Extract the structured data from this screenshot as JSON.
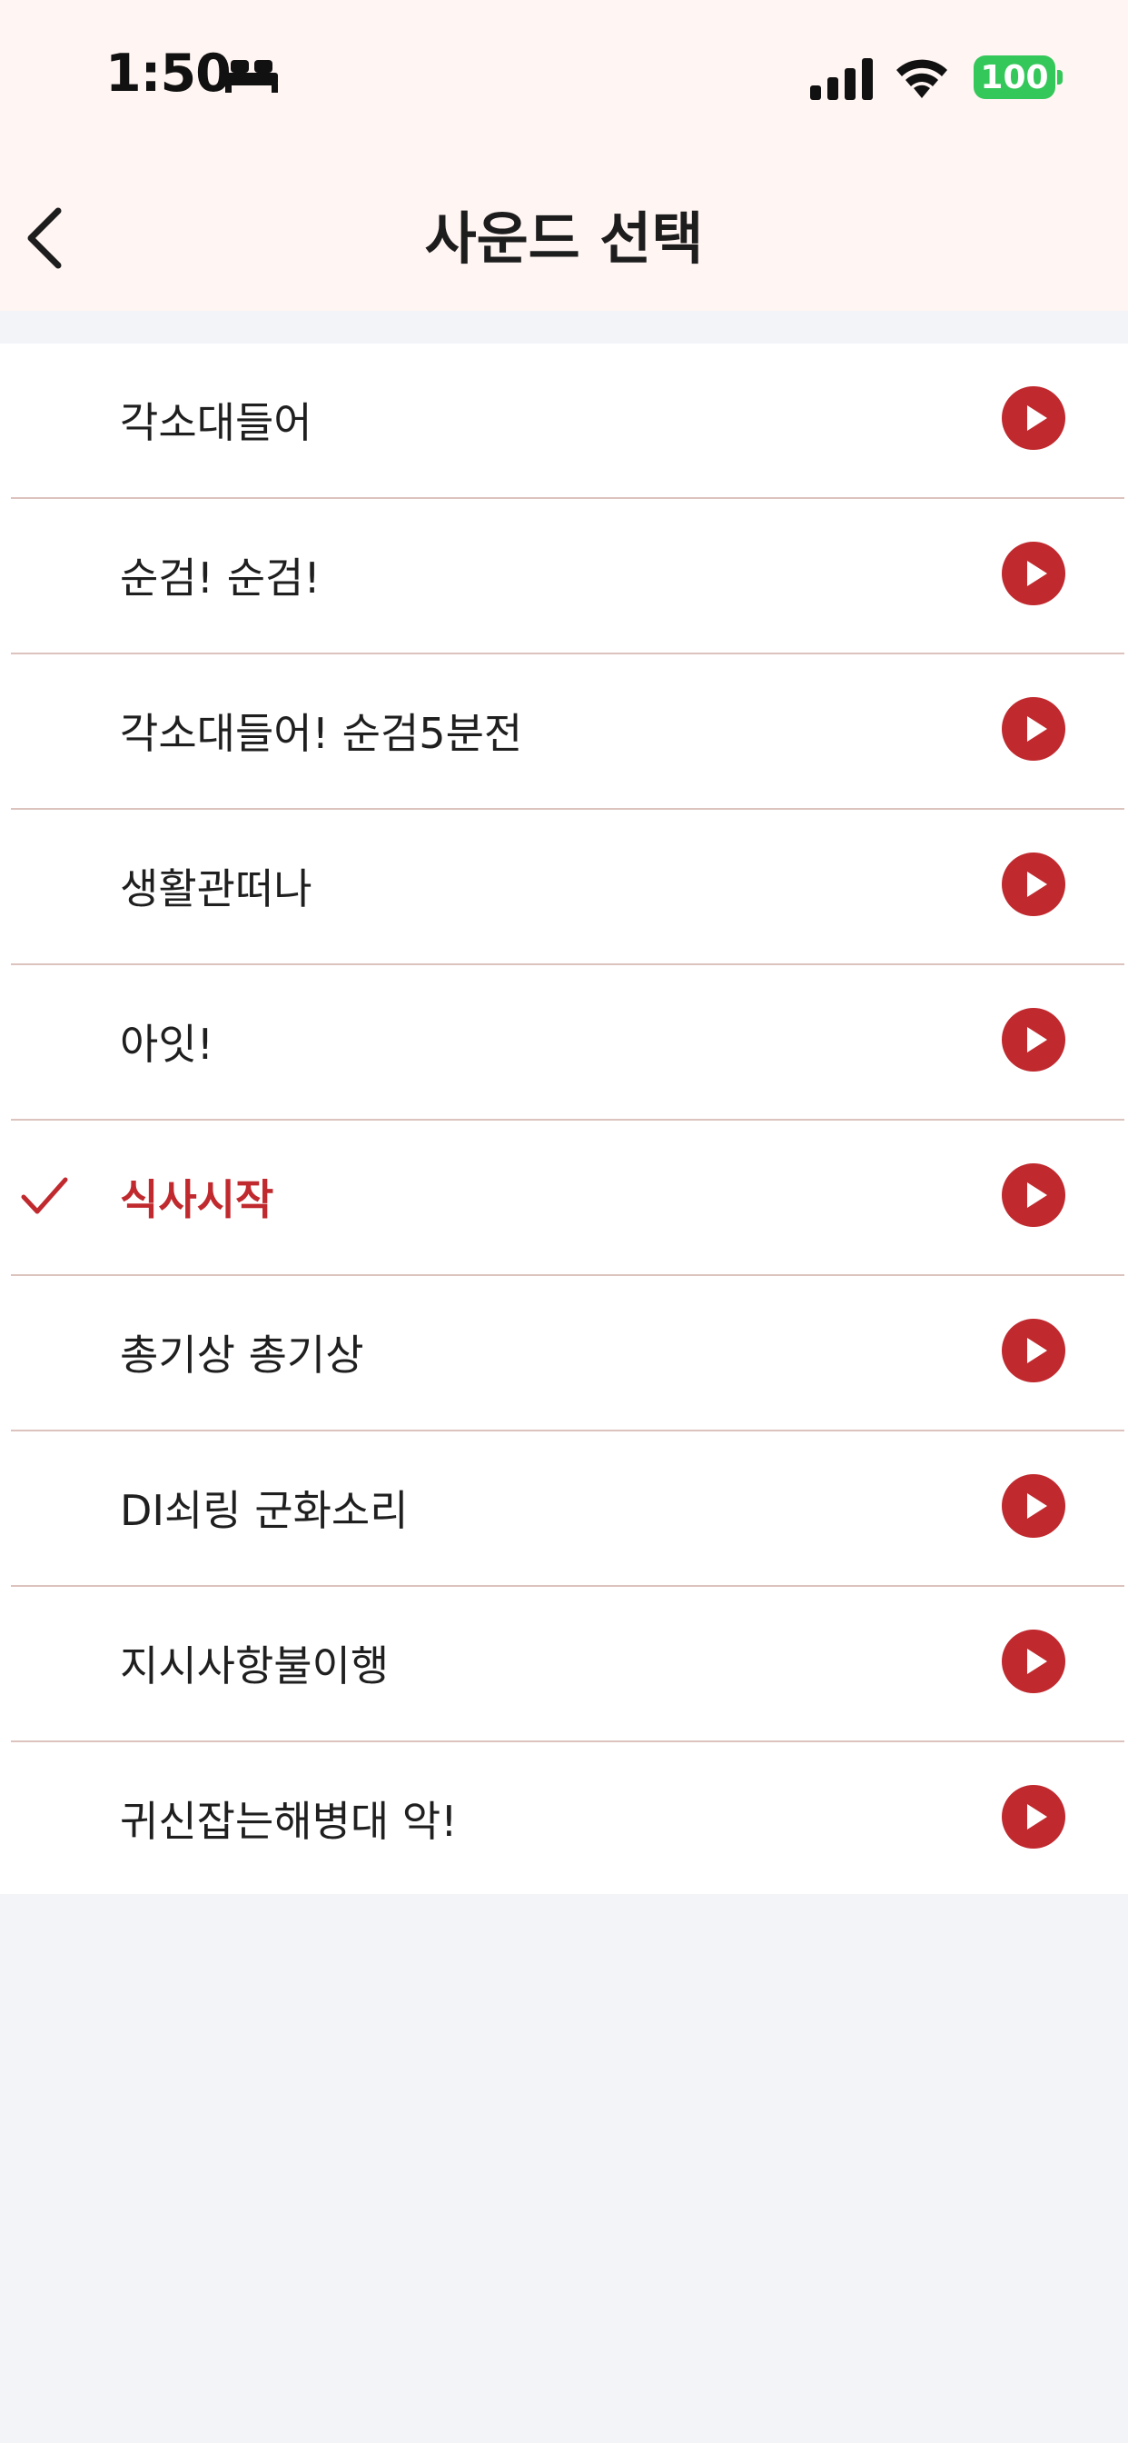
{
  "status_bar": {
    "time": "1:50",
    "battery": "100",
    "icons": [
      "bed-icon",
      "signal-icon",
      "wifi-icon",
      "battery-icon"
    ]
  },
  "nav": {
    "title": "사운드 선택",
    "back_icon": "chevron-left-icon"
  },
  "colors": {
    "accent": "#c0292e",
    "header_bg": "#fff5f3",
    "page_bg": "#f3f4f8",
    "divider": "#dcc3bd",
    "battery": "#34c759"
  },
  "sounds": [
    {
      "label": "각소대들어",
      "selected": false
    },
    {
      "label": "순검! 순검!",
      "selected": false
    },
    {
      "label": "각소대들어! 순검5분전",
      "selected": false
    },
    {
      "label": "생활관떠나",
      "selected": false
    },
    {
      "label": "아잇!",
      "selected": false
    },
    {
      "label": "식사시작",
      "selected": true
    },
    {
      "label": "총기상 총기상",
      "selected": false
    },
    {
      "label": "DI쇠링 군화소리",
      "selected": false
    },
    {
      "label": "지시사항불이행",
      "selected": false
    },
    {
      "label": "귀신잡는해병대 악!",
      "selected": false
    }
  ]
}
